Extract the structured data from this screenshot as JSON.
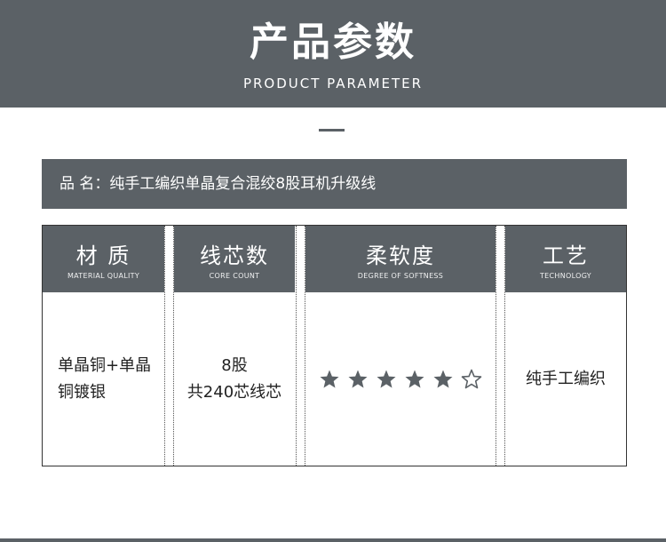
{
  "banner": {
    "title": "产品参数",
    "subtitle": "PRODUCT PARAMETER"
  },
  "product": {
    "name_label": "品   名：纯手工编织单晶复合混绞8股耳机升级线"
  },
  "table": {
    "columns": [
      {
        "title": "材  质",
        "subtitle": "MATERIAL QUALITY",
        "value": "单晶铜+单晶\n铜镀银"
      },
      {
        "title": "线芯数",
        "subtitle": "CORE COUNT",
        "value": "8股\n共240芯线芯"
      },
      {
        "title": "柔软度",
        "subtitle": "DEGREE OF SOFTNESS",
        "rating": 5,
        "rating_max": 6
      },
      {
        "title": "工艺",
        "subtitle": "TECHNOLOGY",
        "value": "纯手工编织"
      }
    ]
  },
  "colors": {
    "primary": "#5b6166",
    "star_filled": "#5b6166",
    "star_empty_stroke": "#5b6166"
  },
  "icons": {
    "filled_star": "star-filled-icon",
    "empty_star": "star-outline-icon"
  }
}
